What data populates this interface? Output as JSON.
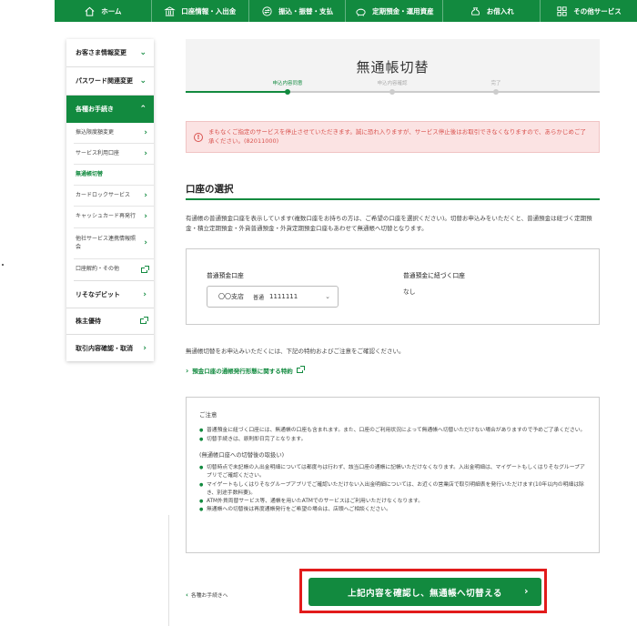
{
  "topnav": {
    "items": [
      {
        "label": "ホーム",
        "icon": "home-icon"
      },
      {
        "label": "口座情報・入出金",
        "icon": "bank-icon"
      },
      {
        "label": "振込・振替・支払",
        "icon": "transfer-icon"
      },
      {
        "label": "定期預金・運用資産",
        "icon": "piggy-bank-icon"
      },
      {
        "label": "お借入れ",
        "icon": "loan-icon"
      },
      {
        "label": "その他サービス",
        "icon": "grid-icon"
      }
    ],
    "color": "#128a3f"
  },
  "sidebar": {
    "items": [
      {
        "label": "お客さま情報変更"
      },
      {
        "label": "パスワード関連変更"
      },
      {
        "label": "各種お手続き"
      },
      {
        "label": "リそなデビット"
      },
      {
        "label": "株主優待"
      },
      {
        "label": "取引内容確認・取消"
      }
    ],
    "subitems": [
      {
        "label": "振込限度額変更"
      },
      {
        "label": "サービス利用口座"
      },
      {
        "label": "無通帳切替"
      },
      {
        "label": "カードロックサービス"
      },
      {
        "label": "キャッシュカード再発行"
      },
      {
        "label": "他社サービス連携情報照会"
      },
      {
        "label": "口座解約・その他"
      }
    ]
  },
  "page": {
    "title": "無通帳切替",
    "steps": [
      "申込内容同意",
      "申込内容確認",
      "完了"
    ]
  },
  "alert": {
    "text": "まもなくご指定のサービスを停止させていただきます。誠に恐れ入りますが、サービス停止後はお取引できなくなりますので、あらかじめご了承ください。(82011000)"
  },
  "account_section": {
    "title": "口座の選択",
    "intro": "有通帳の普通預金口座を表示しています(複数口座をお持ちの方は、ご希望の口座を選択ください)。切替お申込みをいただくと、普通預金は紐づく定期預金・積立定期預金・外貨普通預金・外貨定期預金口座もあわせて無通帳へ切替となります。",
    "savings_label": "普通預金口座",
    "linked_label": "普通預金に紐づく口座",
    "select_branch": "〇〇支店",
    "select_type": "普通",
    "select_number": "1111111",
    "linked_value": "なし"
  },
  "notice": {
    "line": "無通帳切替をお申込みいただくには、下記の特約およびご注意をご確認ください。",
    "policy_link": "預金口座の通帳発行形態に関する特約"
  },
  "caution": {
    "head": "ご注意",
    "bullets": [
      "普通預金に紐づく口座には、無通帳の口座も含まれます。また、口座のご利用状況によって無通帳へ切替いただけない場合がありますので予めご了承ください。",
      "切替手続きは、原則即日完了となります。"
    ],
    "subhead": "(無通帳口座への切替後の取扱い)",
    "bullets2": [
      "切替時点で未記帳の入出金明細については都度与は行わず、該当口座の通帳に記帳いただけなくなります。入出金明細は、マイゲートもしくはりそなグループアプリでご確認ください。",
      "マイゲートもしくはりそなグループアプリでご確認いただけない入出金明細については、お近くの営業店で取引明細表を発行いただけます(10年以内の明細は除き、別途手数料要)。",
      "ATM外貨両替サービス等、通帳を用いたATMでのサービスはご利用いただけなくなります。",
      "無通帳への切替後は再度通帳発行をご希望の場合は、店頭へご相談ください。"
    ]
  },
  "footer": {
    "back_label": "各種お手続きへ",
    "confirm_label": "上記内容を確認し、無通帳へ切替える",
    "highlight_color": "#e21b1b"
  }
}
